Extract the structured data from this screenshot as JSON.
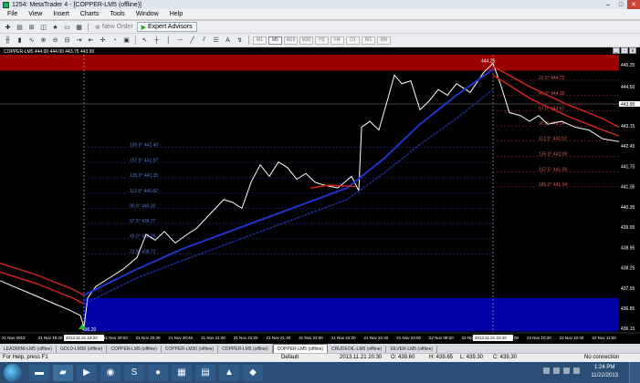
{
  "window": {
    "title": "1254: MetaTrader 4 - [COPPER-LM5 (offline)]"
  },
  "menu": [
    "File",
    "View",
    "Insert",
    "Charts",
    "Tools",
    "Window",
    "Help"
  ],
  "toolbar": {
    "new_order": "New Order",
    "expert_advisors": "Expert Advisors"
  },
  "timeframes": [
    "M1",
    "M5",
    "M15",
    "M30",
    "H1",
    "H4",
    "D1",
    "W1",
    "MN"
  ],
  "active_timeframe": "M5",
  "chart": {
    "title": "COPPER-LM5 444.00 444.00 443.75 443.90",
    "price_ticks": [
      "445.25",
      "444.50",
      "443.90",
      "443.15",
      "442.45",
      "441.75",
      "441.05",
      "440.35",
      "439.65",
      "438.95",
      "438.25",
      "437.55",
      "436.85",
      "436.15"
    ],
    "current_price": "443.90",
    "peak_label": "444.25",
    "low_label": "436.20",
    "time_ticks": [
      "21 Nov 2013",
      "21 Nov 19:20",
      "21 Nov 19:40",
      "21 Nov 20:00",
      "21 Nov 20:20",
      "21 Nov 20:40",
      "21 Nov 21:00",
      "21 Nov 21:20",
      "21 Nov 21:40",
      "21 Nov 22:00",
      "21 Nov 22:20",
      "21 Nov 22:40",
      "21 Nov 23:00",
      "22 Nov 09:20",
      "22 Nov 09:40",
      "22 Nov 10:00",
      "22 Nov 10:20",
      "22 Nov 10:40",
      "22 Nov 11:00"
    ],
    "highlighted_times": [
      "2013.11.21 19:20",
      "2013.11.21 23:40"
    ],
    "fib_blue": [
      {
        "label": "180.0° 442.40",
        "price": 442.4
      },
      {
        "label": "157.5° 441.87",
        "price": 441.87
      },
      {
        "label": "135.0° 441.35",
        "price": 441.35
      },
      {
        "label": "112.5° 440.82",
        "price": 440.82
      },
      {
        "label": "90.0° 440.30",
        "price": 440.3
      },
      {
        "label": "67.5° 439.77",
        "price": 439.77
      },
      {
        "label": "45.0° 439.25",
        "price": 439.25
      },
      {
        "label": "22.5° 438.72",
        "price": 438.72
      }
    ],
    "fib_red": [
      {
        "label": "22.5° 444.72",
        "price": 444.72
      },
      {
        "label": "45.0° 444.19",
        "price": 444.19
      },
      {
        "label": "67.5° 443.67",
        "price": 443.67
      },
      {
        "label": "90.0° 443.14",
        "price": 443.14
      },
      {
        "label": "112.5° 442.62",
        "price": 442.62
      },
      {
        "label": "135.0° 442.09",
        "price": 442.09
      },
      {
        "label": "157.5° 441.56",
        "price": 441.56
      },
      {
        "label": "180.0° 441.04",
        "price": 441.04
      }
    ],
    "colors": {
      "background": "#000000",
      "price_line": "#ffffff",
      "ma_blue": "#2233cc",
      "ma_red": "#cc2222",
      "fib_blue_text": "#5a78d8",
      "fib_red_text": "#d85a5a"
    }
  },
  "tabs": [
    "LEADMINI-LM5 (offline)",
    "GOLD-LM30 (offline)",
    "COPPER-LM5 (offline)",
    "COPPER-LM30 (offline)",
    "COPPER-LM5 (offline)",
    "COPPER-LM5 (offline)",
    "CRUDEOIL-LM5 (offline)",
    "SILVER-LM5 (offline)"
  ],
  "active_tab": 5,
  "status": {
    "help": "For Help, press F1",
    "profile": "Default",
    "time": "2013.11.21 20:30",
    "open": "O: 439.60",
    "high": "H: 439.65",
    "low": "L: 439.30",
    "close": "C: 439.30",
    "connection": "No connection"
  },
  "clock": {
    "time": "1:24 PM",
    "date": "11/22/2013"
  }
}
